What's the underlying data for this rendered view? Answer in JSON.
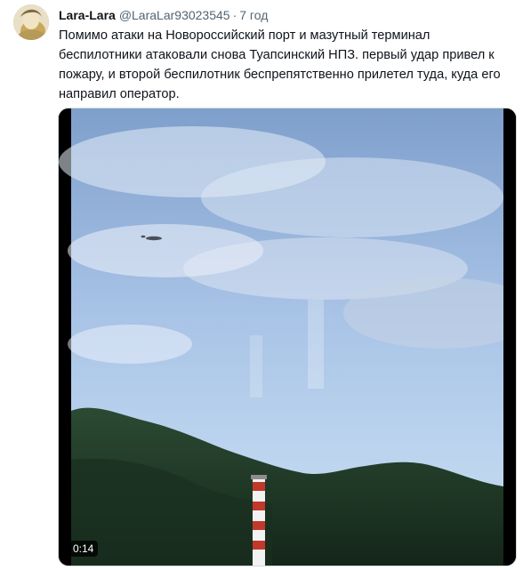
{
  "tweet": {
    "author": {
      "display_name": "Lara-Lara",
      "handle": "@LaraLar93023545",
      "avatar_icon": "avatar-image"
    },
    "separator": "·",
    "time": "7 год",
    "text_lines": [
      "Помимо атаки на Новороссийский порт и мазутный терминал",
      "беспилотники атаковали снова Туапсинский НПЗ. первый удар привел к",
      "пожару, и второй беспилотник беспрепятственно прилетел туда, куда его",
      "направил оператор."
    ],
    "video": {
      "duration": "0:14"
    }
  },
  "colors": {
    "primary_text": "#0f1419",
    "secondary_text": "#536471",
    "border": "#cfd9de",
    "sky_top": "#8fb0d9",
    "sky_bottom": "#b9d2ec",
    "hills": "#1f3a2a",
    "chimney_red": "#c0392b",
    "chimney_white": "#f2f2f2"
  }
}
